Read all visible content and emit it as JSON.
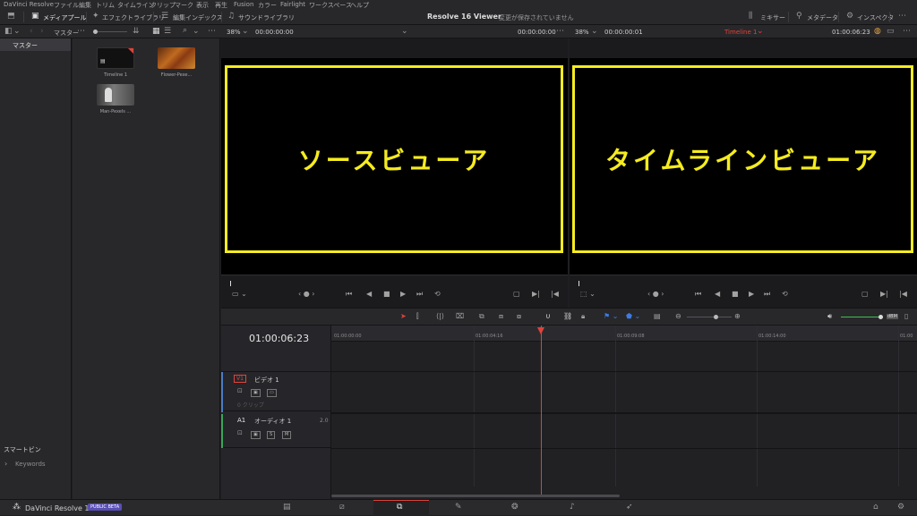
{
  "menu": [
    "DaVinci Resolve",
    "ファイル",
    "編集",
    "トリム",
    "タイムライン",
    "クリップ",
    "マーク",
    "表示",
    "再生",
    "Fusion",
    "カラー",
    "Fairlight",
    "ワークスペース",
    "ヘルプ"
  ],
  "toolbar": {
    "media_pool": "メディアプール",
    "effects_library": "エフェクトライブラリ",
    "edit_index": "編集インデックス",
    "sound_library": "サウンドライブラリ",
    "project_title": "Resolve 16 Viewer",
    "save_status": "変更が保存されていません",
    "mixer": "ミキサー",
    "metadata": "メタデータ",
    "inspector": "インスペクタ"
  },
  "panelbar": {
    "bin_label": "マスター",
    "source_zoom": "38%",
    "source_tc_left": "00:00:00:00",
    "source_tc_right": "00:00:00:00",
    "timeline_zoom": "38%",
    "timeline_tc_left": "00:00:00:01",
    "timeline_name": "Timeline 1",
    "timeline_tc_right": "01:00:06:23"
  },
  "sidebar": {
    "master": "マスター",
    "smart_bins": "スマートビン",
    "keywords": "Keywords"
  },
  "clips": [
    {
      "name": "Timeline 1"
    },
    {
      "name": "Flower-Pexe..."
    },
    {
      "name": "Man-Pexels ..."
    }
  ],
  "viewers": {
    "source_label": "ソースビューア",
    "timeline_label": "タイムラインビューア"
  },
  "timeline": {
    "timecode": "01:00:06:23",
    "ruler": [
      "01:00:00:00",
      "01:00:04:16",
      "01:00:09:08",
      "01:00:14:00",
      "01:00"
    ],
    "v1_label": "V1",
    "v1_name": "ビデオ 1",
    "v1_clips": "0 クリップ",
    "a1_label": "A1",
    "a1_name": "オーディオ 1",
    "a1_channels": "2.0",
    "s_btn": "S",
    "m_btn": "M",
    "db_label": "dBM"
  },
  "bottom": {
    "app_name": "DaVinci Resolve 16",
    "beta": "PUBLIC BETA"
  },
  "colors": {
    "accent_yellow": "#f5ec1f",
    "playhead": "#e0433b",
    "volume_green": "#3fbf4f",
    "video_track": "#4b7cc4",
    "audio_track": "#3aa55a",
    "beta_badge": "#5a4fb4"
  }
}
